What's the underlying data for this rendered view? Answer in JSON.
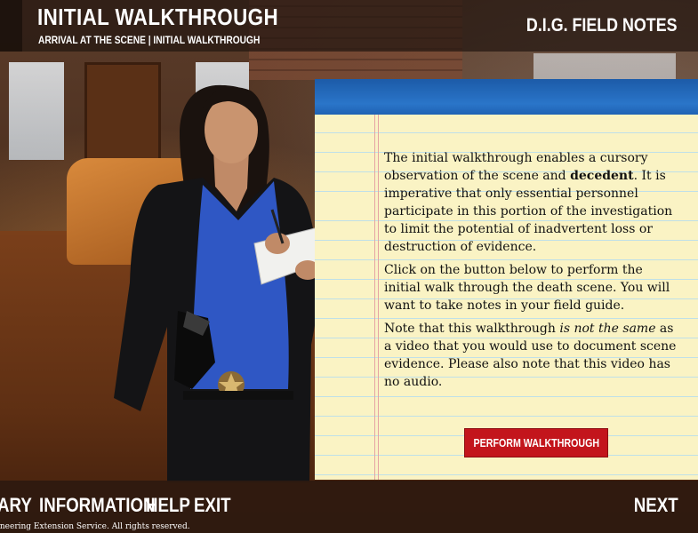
{
  "header": {
    "title": "INITIAL WALKTHROUGH",
    "subtitle": "ARRIVAL AT THE SCENE  |  INITIAL WALKTHROUGH",
    "brand": "D.I.G.  FIELD NOTES"
  },
  "notepad": {
    "p1_a": "The initial walkthrough enables a cursory observation of the scene and ",
    "p1_b": "decedent",
    "p1_c": ". It is imperative that only essential personnel participate in this portion of the investigation to limit the potential of inadvertent loss or destruction of evidence.",
    "p2": "Click on the button below to perform the initial walk through the death scene. You will want to take notes in your field guide.",
    "p3_a": "Note that this walkthrough ",
    "p3_b": "is not the same",
    "p3_c": " as a video that you would use to document scene evidence. Please also note that this video has no audio.",
    "button_label": "PERFORM WALKTHROUGH"
  },
  "footer": {
    "nav_glossary": "ARY",
    "nav_information": "INFORMATION",
    "nav_help": "HELP",
    "nav_exit": "EXIT",
    "nav_next": "NEXT",
    "copyright": "ineering Extension Service. All rights reserved."
  },
  "colors": {
    "accent_red": "#c3151c",
    "notepad_blue": "#2a75c9",
    "notepad_paper": "#faf3c4"
  }
}
